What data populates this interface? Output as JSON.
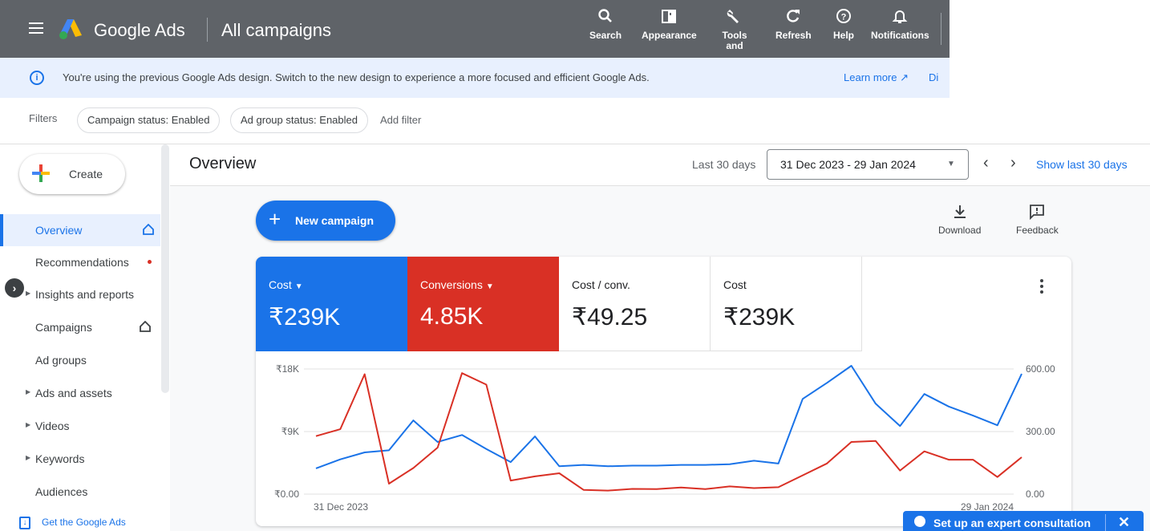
{
  "app": {
    "brand": "Google Ads",
    "context": "All campaigns"
  },
  "toolbar": [
    {
      "label": "Search",
      "icon": "search-icon"
    },
    {
      "label": "Appearance",
      "icon": "appearance-icon"
    },
    {
      "label": "Tools and",
      "icon": "wrench-icon"
    },
    {
      "label": "Refresh",
      "icon": "refresh-icon"
    },
    {
      "label": "Help",
      "icon": "help-icon"
    },
    {
      "label": "Notifications",
      "icon": "bell-icon"
    }
  ],
  "banner": {
    "message": "You're using the previous Google Ads design. Switch to the new design to experience a more focused and efficient Google Ads.",
    "learn_more": "Learn more ↗",
    "dismiss": "Di"
  },
  "filters": {
    "label": "Filters",
    "chips": [
      "Campaign status: Enabled",
      "Ad group status: Enabled"
    ],
    "add": "Add filter"
  },
  "sidebar": {
    "create": "Create",
    "items": [
      {
        "label": "Overview",
        "active": true
      },
      {
        "label": "Recommendations"
      },
      {
        "label": "Insights and reports"
      },
      {
        "label": "Campaigns"
      },
      {
        "label": "Ad groups"
      },
      {
        "label": "Ads and assets"
      },
      {
        "label": "Videos"
      },
      {
        "label": "Keywords"
      },
      {
        "label": "Audiences"
      }
    ],
    "get_app": "Get the Google Ads"
  },
  "main": {
    "title": "Overview",
    "range_label": "Last 30 days",
    "range_value": "31 Dec 2023 - 29 Jan 2024",
    "show_last": "Show last 30 days",
    "new_campaign": "New campaign",
    "download": "Download",
    "feedback": "Feedback"
  },
  "metrics": [
    {
      "name": "Cost",
      "value": "₹239K",
      "color": "#1a73e8"
    },
    {
      "name": "Conversions",
      "value": "4.85K",
      "color": "#d93025"
    },
    {
      "name": "Cost / conv.",
      "value": "₹49.25"
    },
    {
      "name": "Cost",
      "value": "₹239K"
    }
  ],
  "consultation": {
    "label": "Set up an expert consultation",
    "close": "✕"
  },
  "chart_data": {
    "type": "line",
    "x_start_label": "31 Dec 2023",
    "x_end_label": "29 Jan 2024",
    "left_axis": {
      "ticks": [
        "₹18K",
        "₹9K",
        "₹0.00"
      ],
      "ylim": [
        0,
        18000
      ]
    },
    "right_axis": {
      "ticks": [
        "600.00",
        "300.00",
        "0.00"
      ],
      "ylim": [
        0,
        600
      ]
    },
    "series": [
      {
        "name": "Cost",
        "axis": "left",
        "color": "#1a73e8",
        "values": [
          3700,
          5000,
          6000,
          6300,
          10600,
          7500,
          8500,
          6500,
          4600,
          8300,
          4000,
          4200,
          4000,
          4100,
          4100,
          4200,
          4200,
          4300,
          4800,
          4400,
          13700,
          16000,
          20200,
          13000,
          9800,
          14400,
          12600,
          11300,
          9900,
          17300
        ]
      },
      {
        "name": "Conversions",
        "axis": "right",
        "color": "#d93025",
        "values": [
          278,
          311,
          575,
          50,
          125,
          223,
          580,
          525,
          65,
          85,
          100,
          20,
          17,
          25,
          24,
          32,
          24,
          37,
          29,
          33,
          90,
          147,
          250,
          255,
          113,
          205,
          165,
          165,
          82,
          177
        ]
      }
    ]
  }
}
